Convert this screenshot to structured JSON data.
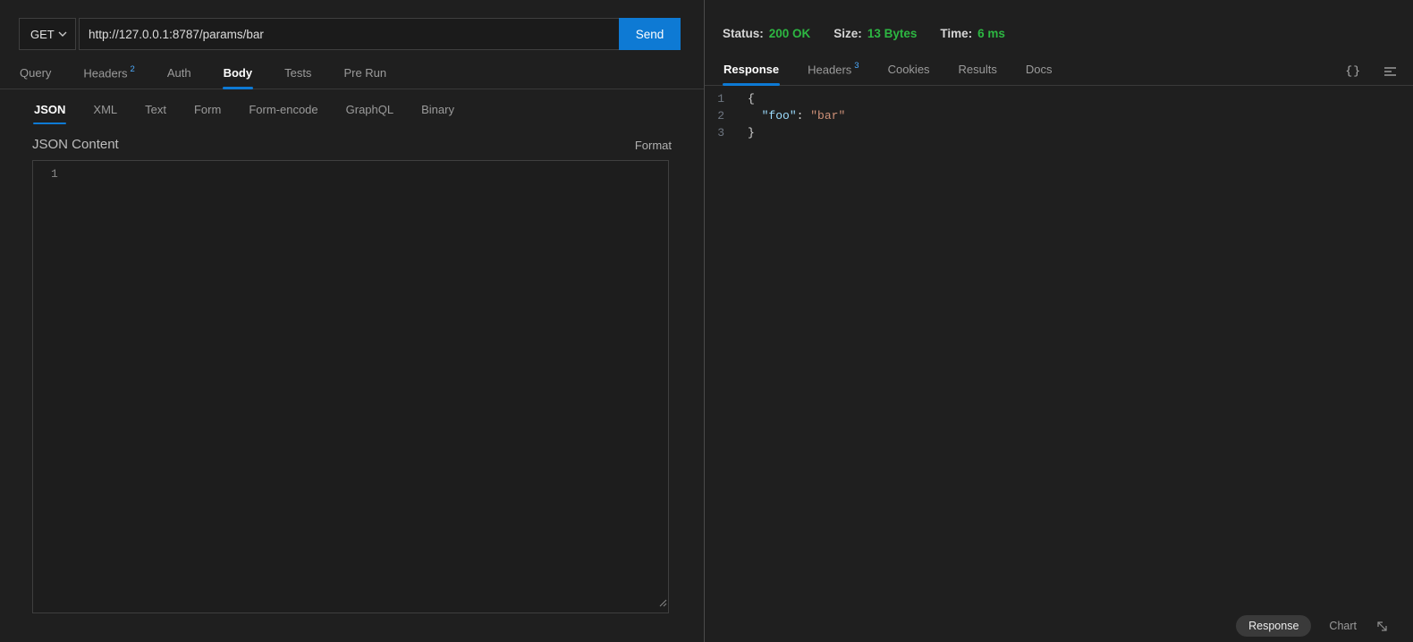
{
  "request": {
    "method": "GET",
    "url": "http://127.0.0.1:8787/params/bar",
    "send_label": "Send",
    "tabs": [
      {
        "label": "Query",
        "badge": ""
      },
      {
        "label": "Headers",
        "badge": "2"
      },
      {
        "label": "Auth",
        "badge": ""
      },
      {
        "label": "Body",
        "badge": ""
      },
      {
        "label": "Tests",
        "badge": ""
      },
      {
        "label": "Pre Run",
        "badge": ""
      }
    ],
    "active_tab": "Body",
    "body_tabs": [
      "JSON",
      "XML",
      "Text",
      "Form",
      "Form-encode",
      "GraphQL",
      "Binary"
    ],
    "active_body_tab": "JSON",
    "content_label": "JSON Content",
    "format_label": "Format",
    "editor": {
      "line_number": "1",
      "value": ""
    }
  },
  "response": {
    "status": {
      "label": "Status:",
      "value": "200 OK"
    },
    "size": {
      "label": "Size:",
      "value": "13 Bytes"
    },
    "time": {
      "label": "Time:",
      "value": "6 ms"
    },
    "tabs": [
      {
        "label": "Response",
        "badge": ""
      },
      {
        "label": "Headers",
        "badge": "3"
      },
      {
        "label": "Cookies",
        "badge": ""
      },
      {
        "label": "Results",
        "badge": ""
      },
      {
        "label": "Docs",
        "badge": ""
      }
    ],
    "active_tab": "Response",
    "braces_icon_glyph": "{}",
    "code_lines": [
      {
        "num": "1",
        "indent": "",
        "key": "",
        "colon": "",
        "value": "",
        "bracket": "{"
      },
      {
        "num": "2",
        "indent": "  ",
        "key": "\"foo\"",
        "colon": ": ",
        "value": "\"bar\"",
        "bracket": ""
      },
      {
        "num": "3",
        "indent": "",
        "key": "",
        "colon": "",
        "value": "",
        "bracket": "}"
      }
    ],
    "body_json": {
      "foo": "bar"
    },
    "footer": {
      "response_label": "Response",
      "chart_label": "Chart"
    }
  },
  "colors": {
    "accent_blue": "#0e7ad4",
    "success_green": "#2db742",
    "badge_blue": "#4daafc",
    "json_key": "#9cdcfe",
    "json_string": "#ce9178",
    "punctuation": "#d4d4d4"
  }
}
